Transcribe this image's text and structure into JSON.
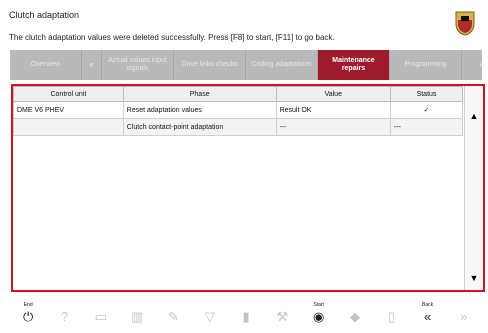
{
  "header": {
    "title": "Clutch adaptation",
    "message": "The clutch adaptation values were deleted successfully. Press [F8] to start, [F11] to go back."
  },
  "tabs": [
    {
      "label": "Overview"
    },
    {
      "label": "«"
    },
    {
      "label": "Actual values input signals"
    },
    {
      "label": "Drive links checks"
    },
    {
      "label": "Coding adaptations"
    },
    {
      "label": "Maintenance repairs"
    },
    {
      "label": "Programming"
    },
    {
      "label": "»"
    }
  ],
  "table": {
    "columns": [
      "Control unit",
      "Phase",
      "Value",
      "Status"
    ],
    "rows": [
      [
        "DME V6 PHEV",
        "Reset adaptation values",
        "Result OK",
        "✓"
      ],
      [
        "",
        "Clutch contact-point adaptation",
        "---",
        "---"
      ]
    ]
  },
  "toolbar": {
    "items": [
      {
        "key": "End",
        "icon": "power-icon"
      },
      {
        "key": "",
        "icon": "help-icon"
      },
      {
        "key": "",
        "icon": "card-icon"
      },
      {
        "key": "",
        "icon": "chart-icon"
      },
      {
        "key": "",
        "icon": "edit-icon"
      },
      {
        "key": "",
        "icon": "filter-icon"
      },
      {
        "key": "",
        "icon": "trash-icon"
      },
      {
        "key": "",
        "icon": "wrench-icon"
      },
      {
        "key": "Start",
        "icon": "play-icon"
      },
      {
        "key": "",
        "icon": "car-icon"
      },
      {
        "key": "",
        "icon": "copy-icon"
      },
      {
        "key": "Back",
        "icon": "back-icon"
      },
      {
        "key": "",
        "icon": "next-icon"
      }
    ]
  }
}
